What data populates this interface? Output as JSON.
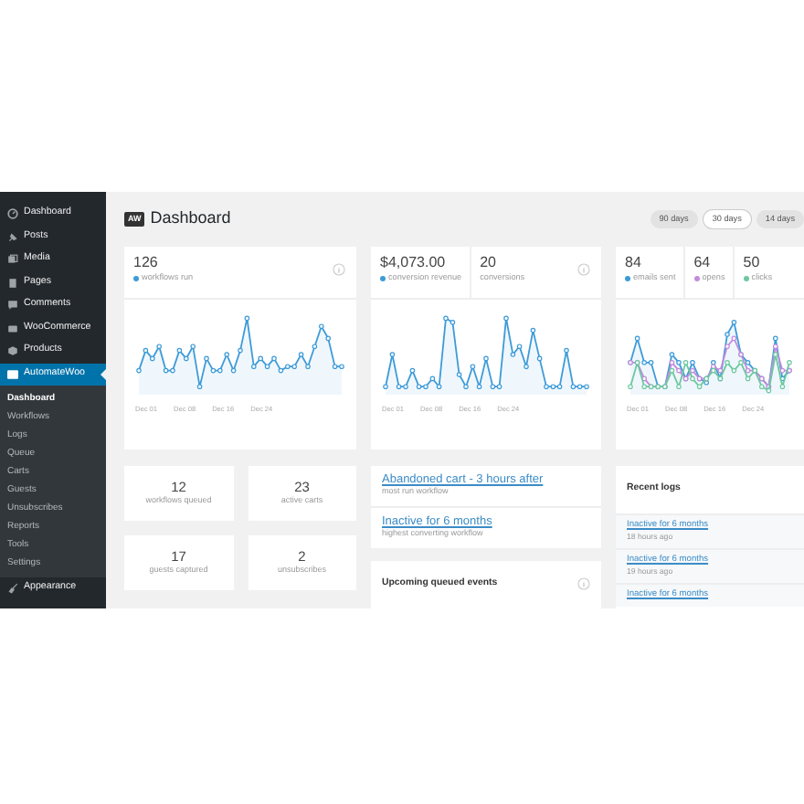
{
  "sidebar": {
    "items": [
      {
        "label": "Dashboard",
        "selected": false
      },
      {
        "label": "Posts",
        "selected": false
      },
      {
        "label": "Media",
        "selected": false
      },
      {
        "label": "Pages",
        "selected": false
      },
      {
        "label": "Comments",
        "selected": false
      },
      {
        "label": "WooCommerce",
        "selected": false
      },
      {
        "label": "Products",
        "selected": false
      },
      {
        "label": "AutomateWoo",
        "selected": true,
        "children": [
          {
            "label": "Dashboard",
            "selected": true
          },
          {
            "label": "Workflows",
            "selected": false
          },
          {
            "label": "Logs",
            "selected": false
          },
          {
            "label": "Queue",
            "selected": false
          },
          {
            "label": "Carts",
            "selected": false
          },
          {
            "label": "Guests",
            "selected": false
          },
          {
            "label": "Unsubscribes",
            "selected": false
          },
          {
            "label": "Reports",
            "selected": false
          },
          {
            "label": "Tools",
            "selected": false
          },
          {
            "label": "Settings",
            "selected": false
          }
        ]
      },
      {
        "label": "Appearance",
        "selected": false
      }
    ]
  },
  "page": {
    "logo": "AW",
    "title": "Dashboard"
  },
  "ranges": [
    {
      "label": "90 days",
      "selected": false
    },
    {
      "label": "30 days",
      "selected": true
    },
    {
      "label": "14 days",
      "selected": false
    }
  ],
  "charts": [
    {
      "metrics": [
        {
          "value": "126",
          "label": "workflows run",
          "color": "#3d9bd8"
        }
      ],
      "x_labels": [
        "Dec 01",
        "Dec 08",
        "Dec 16",
        "Dec 24"
      ]
    },
    {
      "metrics": [
        {
          "value": "$4,073.00",
          "label": "conversion revenue",
          "color": "#3d9bd8"
        },
        {
          "value": "20",
          "label": "conversions"
        }
      ],
      "x_labels": [
        "Dec 01",
        "Dec 08",
        "Dec 16",
        "Dec 24"
      ]
    },
    {
      "metrics": [
        {
          "value": "84",
          "label": "emails sent",
          "color": "#3d9bd8"
        },
        {
          "value": "64",
          "label": "opens",
          "color": "#c38bdc"
        },
        {
          "value": "50",
          "label": "clicks",
          "color": "#6cc8a0"
        }
      ],
      "x_labels": [
        "Dec 01",
        "Dec 08",
        "Dec 16",
        "Dec 24"
      ]
    }
  ],
  "stats": [
    {
      "value": "12",
      "label": "workflows queued"
    },
    {
      "value": "23",
      "label": "active carts"
    },
    {
      "value": "17",
      "label": "guests captured"
    },
    {
      "value": "2",
      "label": "unsubscribes"
    }
  ],
  "highlights": [
    {
      "title": "Abandoned cart - 3 hours after",
      "caption": "most run workflow"
    },
    {
      "title": "Inactive for 6 months",
      "caption": "highest converting workflow"
    }
  ],
  "upcoming": {
    "title": "Upcoming queued events"
  },
  "recent_logs": {
    "title": "Recent logs",
    "items": [
      {
        "title": "Inactive for 6 months",
        "time": "18 hours ago"
      },
      {
        "title": "Inactive for 6 months",
        "time": "19 hours ago"
      },
      {
        "title": "Inactive for 6 months"
      }
    ]
  }
}
